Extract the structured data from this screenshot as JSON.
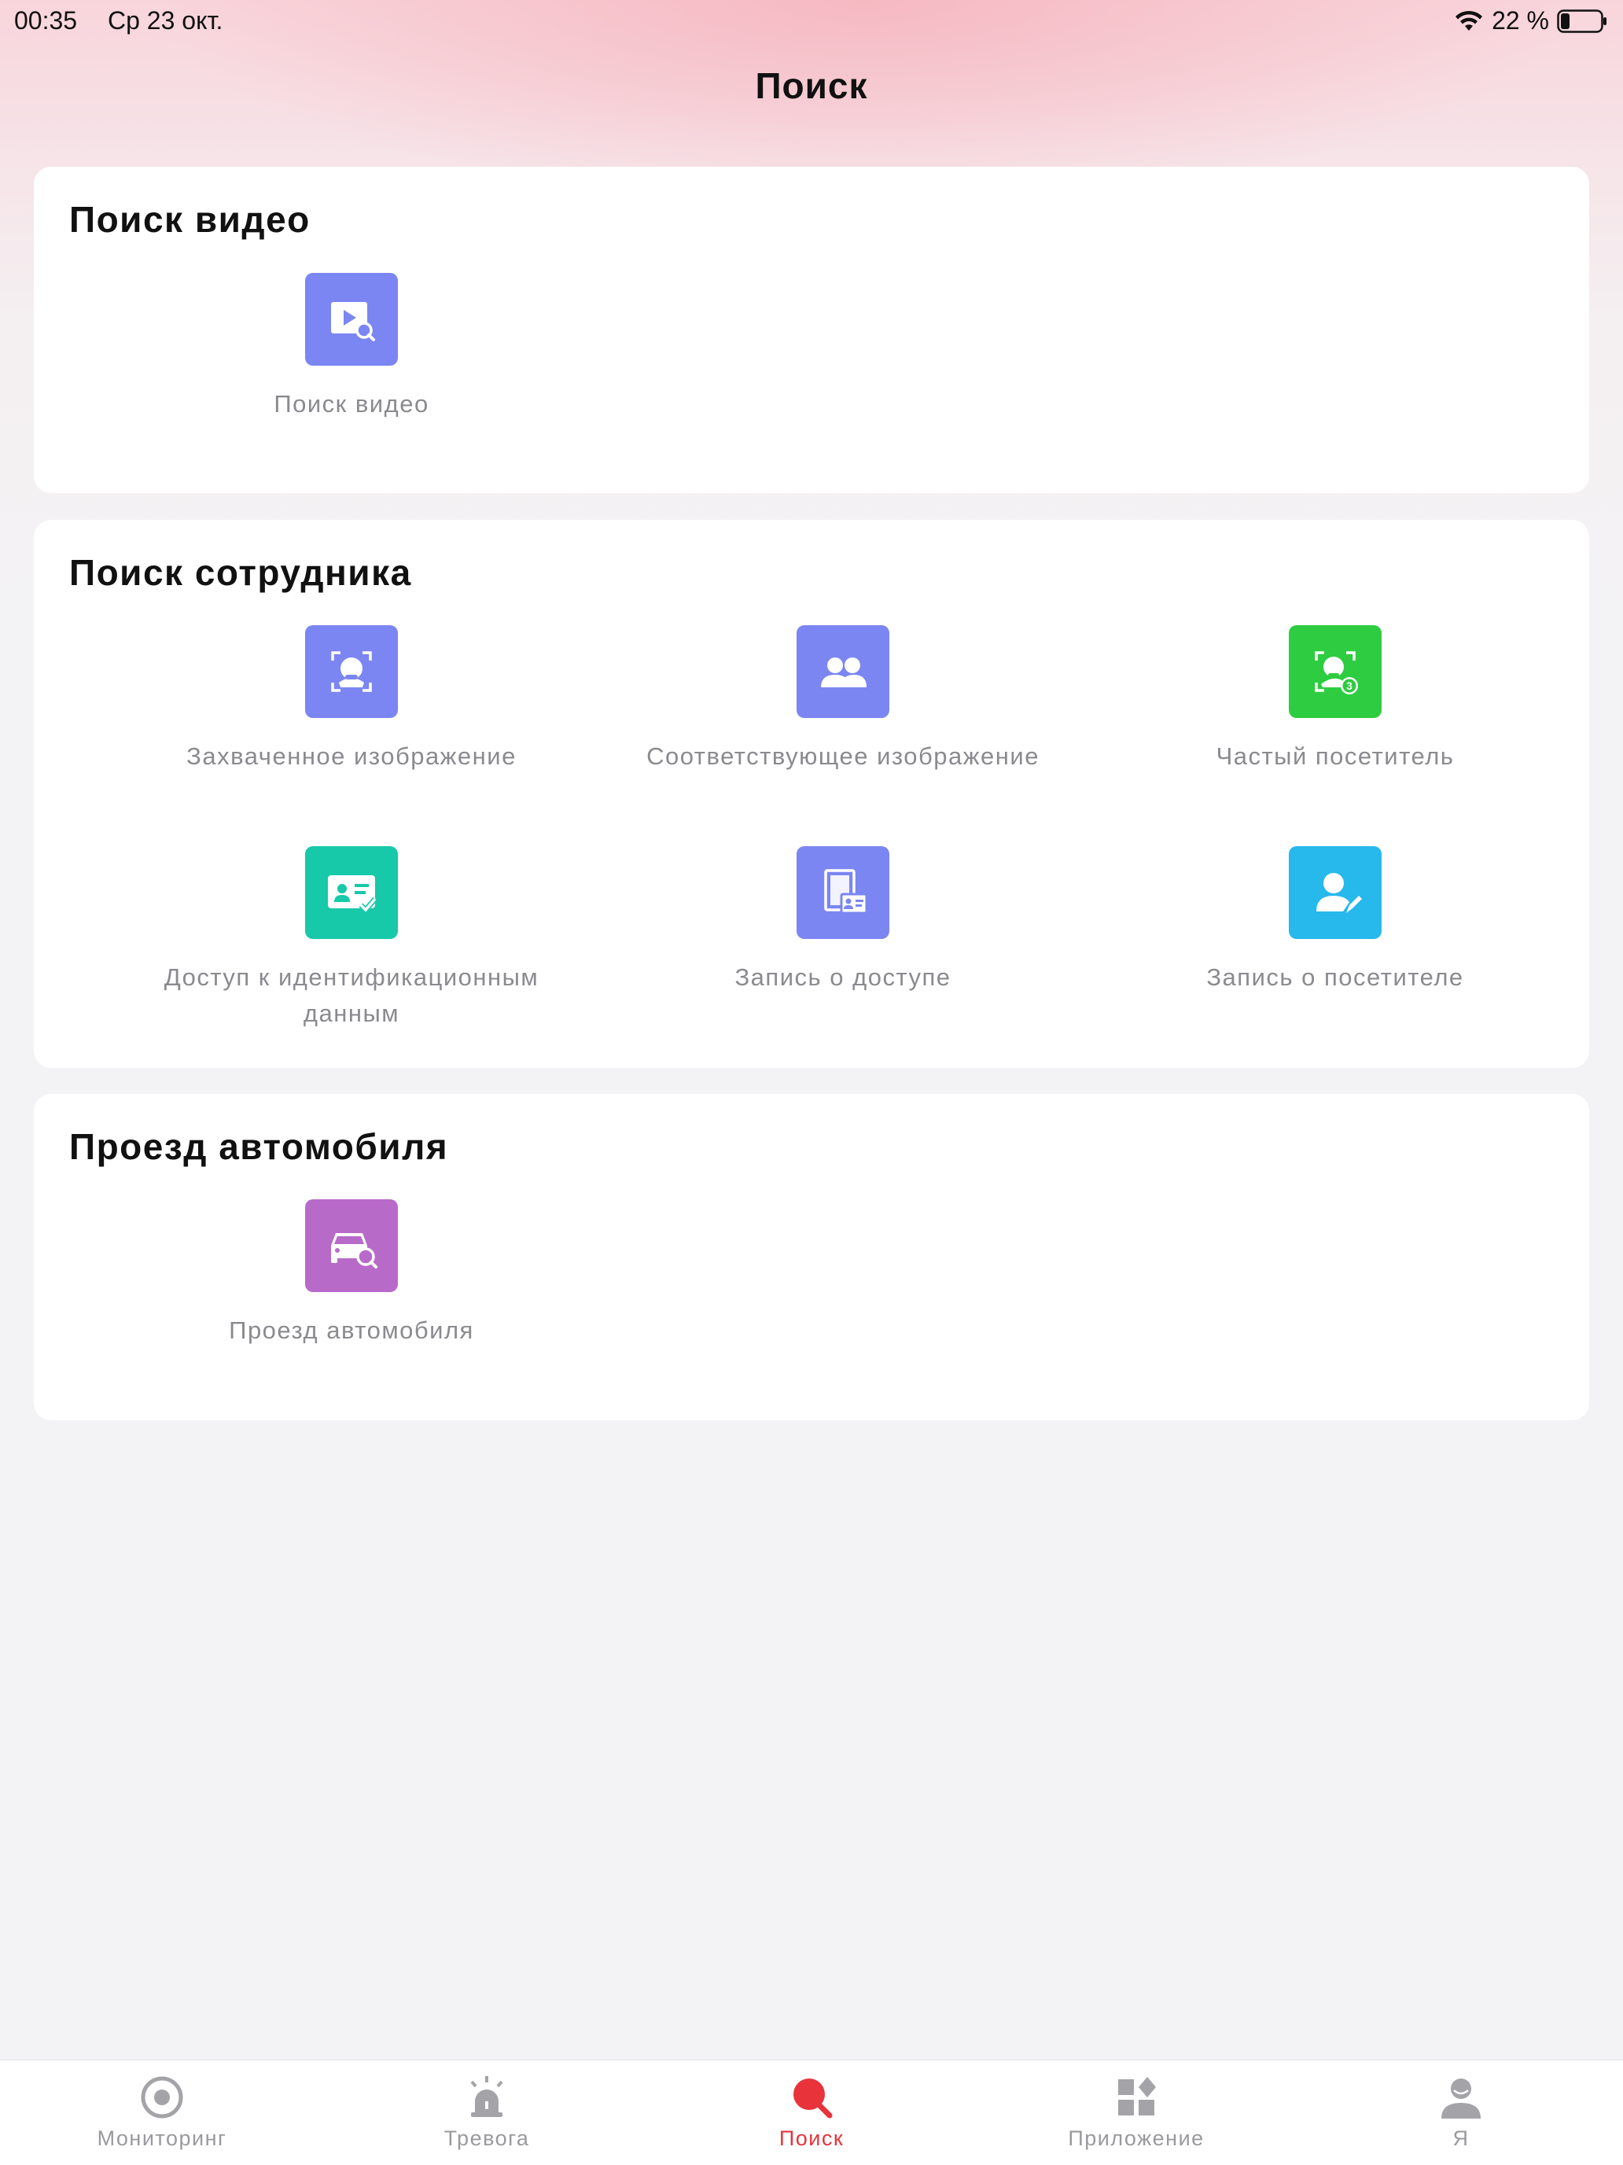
{
  "status_bar": {
    "time": "00:35",
    "date": "Ср 23 окт.",
    "battery": "22 %"
  },
  "page": {
    "title": "Поиск"
  },
  "sections": [
    {
      "title": "Поиск видео",
      "items": [
        {
          "label": "Поиск видео",
          "icon": "video-search-icon",
          "color": "#7b86f2"
        }
      ]
    },
    {
      "title": "Поиск сотрудника",
      "items": [
        {
          "label": "Захваченное изображение",
          "icon": "face-capture-icon",
          "color": "#7b86f2"
        },
        {
          "label": "Соответствующее изображение",
          "icon": "people-match-icon",
          "color": "#7b86f2"
        },
        {
          "label": "Частый посетитель",
          "icon": "frequent-visitor-icon",
          "color": "#2ecc40"
        },
        {
          "label": "Доступ к идентификационным данным",
          "icon": "id-access-icon",
          "color": "#17c9a8"
        },
        {
          "label": "Запись о доступе",
          "icon": "access-record-icon",
          "color": "#7b86f2"
        },
        {
          "label": "Запись о посетителе",
          "icon": "visitor-record-icon",
          "color": "#27b8ec"
        }
      ]
    },
    {
      "title": "Проезд автомобиля",
      "items": [
        {
          "label": "Проезд автомобиля",
          "icon": "vehicle-search-icon",
          "color": "#b86ac9"
        }
      ]
    }
  ],
  "tab_bar": {
    "tabs": [
      {
        "label": "Мониторинг",
        "icon": "monitoring-icon"
      },
      {
        "label": "Тревога",
        "icon": "alarm-icon"
      },
      {
        "label": "Поиск",
        "icon": "search-icon",
        "active": true
      },
      {
        "label": "Приложение",
        "icon": "apps-icon"
      },
      {
        "label": "Я",
        "icon": "profile-icon"
      }
    ],
    "active_color": "#e8333b",
    "inactive_color": "#9a9a9e"
  }
}
